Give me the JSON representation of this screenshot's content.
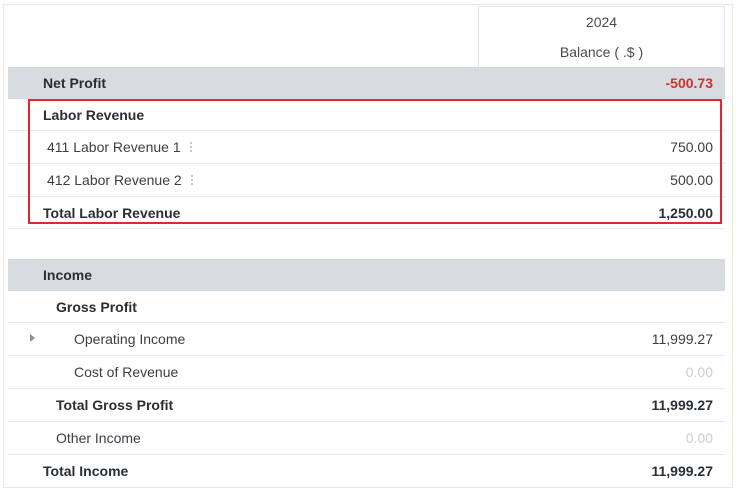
{
  "header": {
    "year": "2024",
    "column": "Balance ( .$ )"
  },
  "net_profit": {
    "label": "Net Profit",
    "value": "-500.73"
  },
  "labor_revenue": {
    "title": "Labor Revenue",
    "items": [
      {
        "label": "411 Labor Revenue 1",
        "value": "750.00"
      },
      {
        "label": "412 Labor Revenue 2",
        "value": "500.00"
      }
    ],
    "total_label": "Total Labor Revenue",
    "total_value": "1,250.00"
  },
  "income": {
    "title": "Income",
    "gross_profit": {
      "title": "Gross Profit",
      "operating_income": {
        "label": "Operating Income",
        "value": "11,999.27"
      },
      "cost_of_revenue": {
        "label": "Cost of Revenue",
        "value": "0.00"
      },
      "total_label": "Total Gross Profit",
      "total_value": "11,999.27"
    },
    "other_income": {
      "label": "Other Income",
      "value": "0.00"
    },
    "total_label": "Total Income",
    "total_value": "11,999.27"
  },
  "colors": {
    "negative": "#d0312d",
    "highlight_border": "#e3262d",
    "section_background": "#d8dbdf"
  }
}
